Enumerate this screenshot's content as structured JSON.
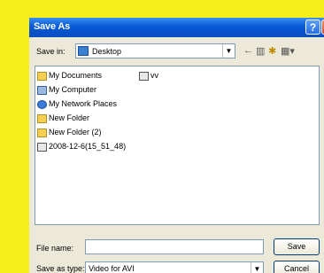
{
  "window": {
    "title": "Save As",
    "help": "?",
    "close": "x"
  },
  "save_in": {
    "label": "Save in:",
    "value": "Desktop"
  },
  "toolbar": {
    "back": "←",
    "up": "▥",
    "new_folder": "✱",
    "views": "▦▾"
  },
  "files": [
    {
      "name": "My Documents",
      "icon": "documents-folder-icon"
    },
    {
      "name": "vv",
      "icon": "file-icon"
    },
    {
      "name": "My Computer",
      "icon": "computer-icon"
    },
    {
      "name": "My Network Places",
      "icon": "network-icon"
    },
    {
      "name": "New Folder",
      "icon": "folder-icon"
    },
    {
      "name": "New Folder (2)",
      "icon": "folder-icon"
    },
    {
      "name": "2008-12-6(15_51_48)",
      "icon": "file-icon"
    }
  ],
  "file_name": {
    "label": "File name:",
    "value": ""
  },
  "save_as_type": {
    "label": "Save as type:",
    "value": "Video for AVI"
  },
  "buttons": {
    "save": "Save",
    "cancel": "Cancel"
  },
  "colors": {
    "background": "#f7ef1b",
    "titlebar": "#0a5ed8",
    "dialog": "#ece9d8"
  }
}
